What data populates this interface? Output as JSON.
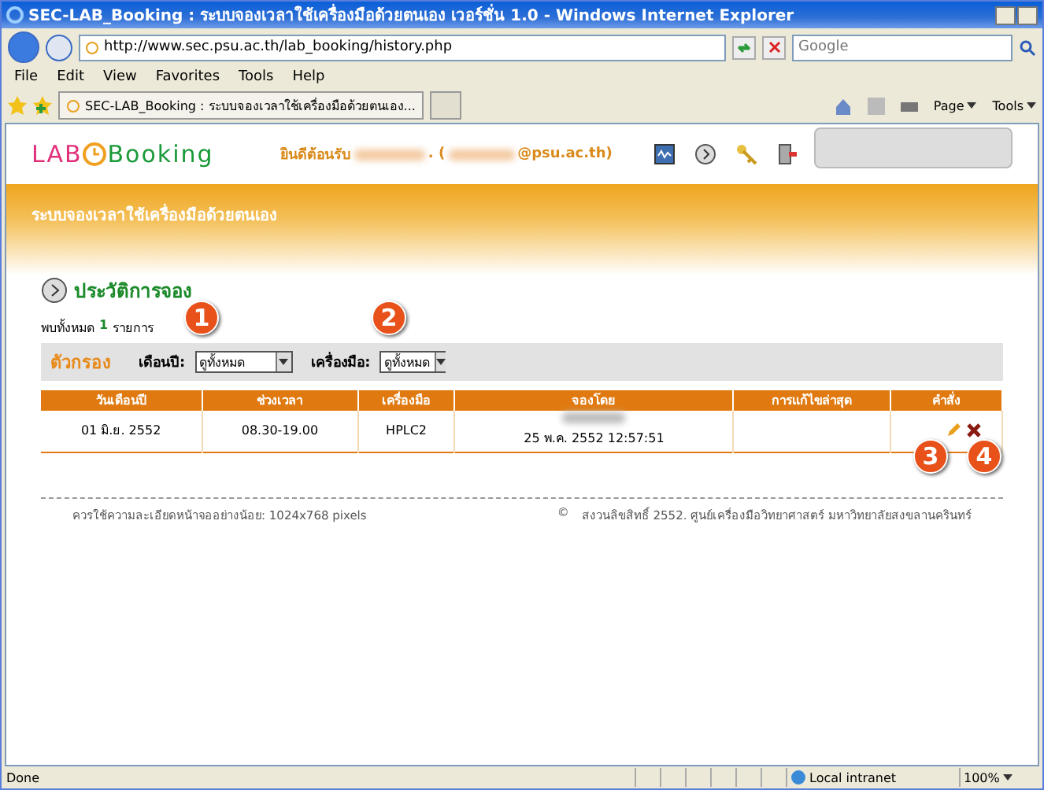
{
  "window": {
    "title": "SEC-LAB_Booking : ระบบจองเวลาใช้เครื่องมือด้วยตนเอง เวอร์ชั่น 1.0 - Windows Internet Explorer"
  },
  "address": "http://www.sec.psu.ac.th/lab_booking/history.php",
  "search": {
    "placeholder": "Google"
  },
  "menu": [
    "File",
    "Edit",
    "View",
    "Favorites",
    "Tools",
    "Help"
  ],
  "tab": {
    "label": "SEC-LAB_Booking : ระบบจองเวลาใช้เครื่องมือด้วยตนเอง..."
  },
  "command_bar": [
    "Page",
    "Tools"
  ],
  "header": {
    "logo_left": "LAB",
    "logo_right": "Booking",
    "welcome": "ยินดีต้อนรับ",
    "email_open": ". (",
    "email_domain": "@psu.ac.th)"
  },
  "banner": "ระบบจองเวลาใช้เครื่องมือด้วยตนเอง",
  "section_title": "ประวัติการจอง",
  "count": {
    "prefix": "พบทั้งหมด",
    "value": "1",
    "suffix": "รายการ"
  },
  "filter": {
    "title": "ตัวกรอง",
    "fields": [
      {
        "label": "เดือนปี:",
        "value": "ดูทั้งหมด"
      },
      {
        "label": "เครื่องมือ:",
        "value": "ดูทั้งหมด"
      }
    ]
  },
  "table": {
    "columns": [
      "วันเดือนปี",
      "ช่วงเวลา",
      "เครื่องมือ",
      "จองโดย",
      "การแก้ไขล่าสุด",
      "คำสั่ง"
    ],
    "rows": [
      {
        "date": "01 มิ.ย. 2552",
        "time": "08.30-19.00",
        "instrument": "HPLC2",
        "booked_at": "25 พ.ค. 2552 12:57:51"
      }
    ]
  },
  "callouts": [
    "1",
    "2",
    "3",
    "4"
  ],
  "footer": {
    "left": "ควรใช้ความละเอียดหน้าจออย่างน้อย: 1024x768 pixels",
    "copyright_symbol": "©",
    "right": "สงวนลิขสิทธิ์ 2552. ศูนย์เครื่องมือวิทยาศาสตร์ มหาวิทยาลัยสงขลานครินทร์"
  },
  "status_bar": {
    "text": "Done",
    "zone": "Local intranet",
    "zoom": "100%"
  }
}
